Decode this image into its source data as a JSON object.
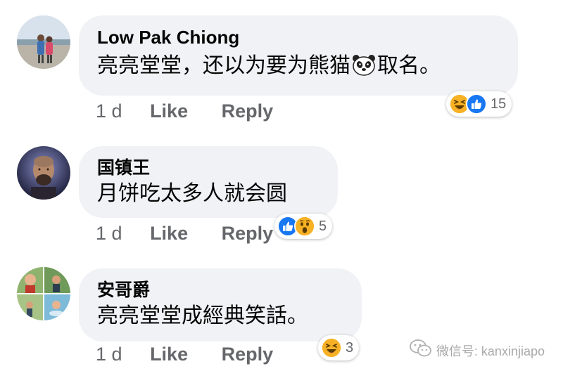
{
  "comments": [
    {
      "author": "Low Pak Chiong",
      "text_before": "亮亮堂堂，还以为要为熊猫",
      "text_after": "取名。",
      "time": "1 d",
      "like": "Like",
      "reply": "Reply",
      "reaction_count": "15",
      "reactions": [
        "haha-icon",
        "like-icon"
      ]
    },
    {
      "author": "国镇王",
      "text": "月饼吃太多人就会圆",
      "time": "1 d",
      "like": "Like",
      "reply": "Reply",
      "reaction_count": "5",
      "reactions": [
        "like-icon",
        "wow-icon"
      ]
    },
    {
      "author": "安哥爵",
      "text": "亮亮堂堂成經典笑話。",
      "time": "1 d",
      "like": "Like",
      "reply": "Reply",
      "reaction_count": "3",
      "reactions": [
        "haha-icon"
      ]
    }
  ],
  "watermark": {
    "text": "微信号: kanxinjiapo",
    "icon": "wechat-icon"
  },
  "colors": {
    "bubble": "#f0f2f5",
    "meta_text": "#65676b",
    "like_blue": "#1877f2",
    "reaction_yellow": "#f7b125"
  }
}
